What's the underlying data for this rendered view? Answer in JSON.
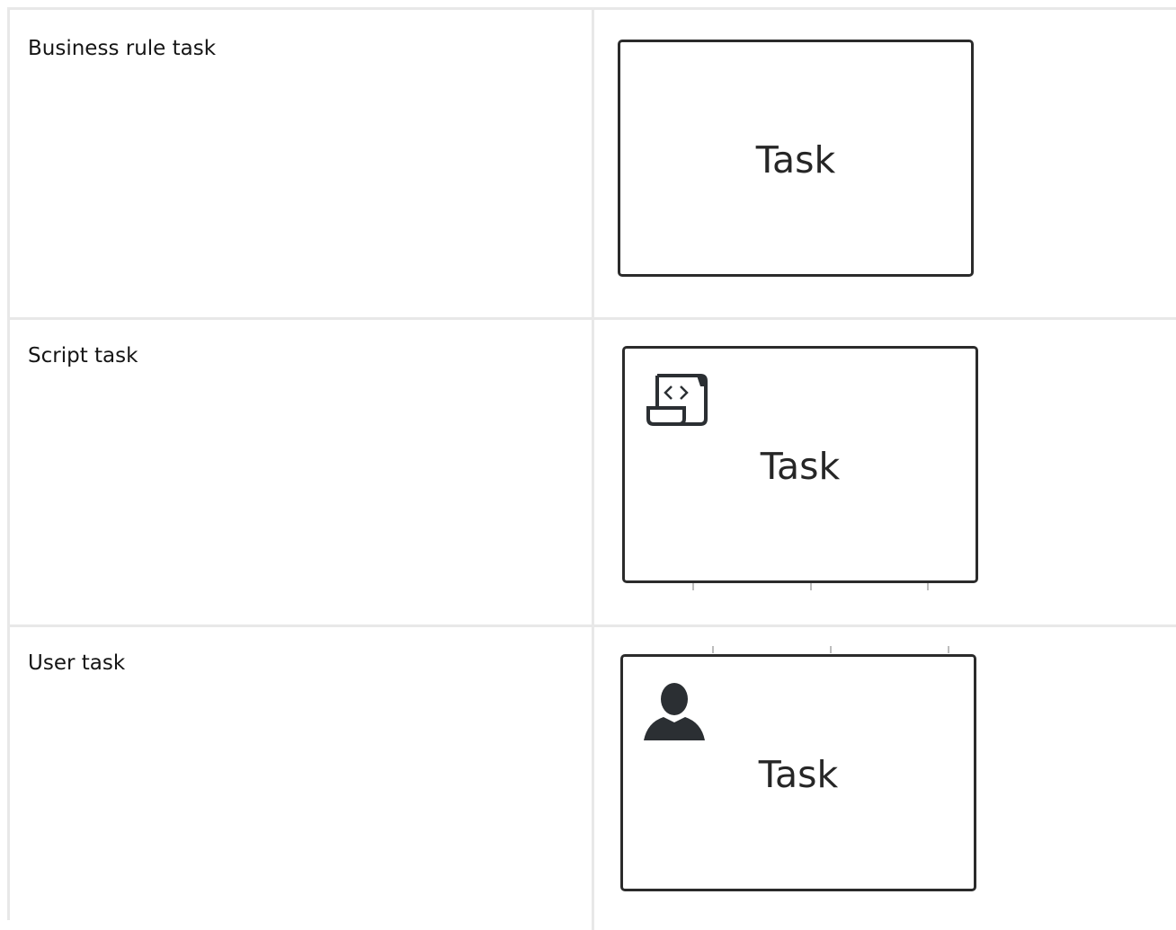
{
  "rows": [
    {
      "label": "Business rule task",
      "task_label": "Task",
      "icon": "none"
    },
    {
      "label": "Script task",
      "task_label": "Task",
      "icon": "script-icon"
    },
    {
      "label": "User task",
      "task_label": "Task",
      "icon": "user-icon"
    }
  ],
  "colors": {
    "border": "#e8e8e8",
    "task_stroke": "#2b2b2b",
    "icon_fill": "#2b2f33"
  }
}
